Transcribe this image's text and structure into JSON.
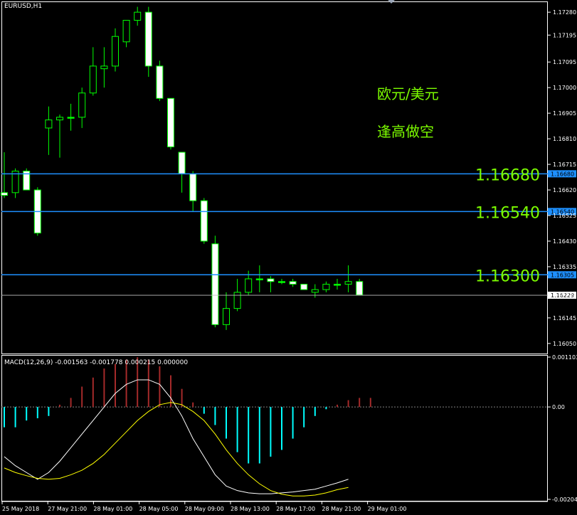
{
  "chart_data": {
    "type": "candlestick",
    "symbol_title": "EURUSD,H1",
    "price_axis": {
      "min": 1.1601,
      "max": 1.1732,
      "ticks": [
        "1.17280",
        "1.17195",
        "1.17095",
        "1.17000",
        "1.16905",
        "1.16810",
        "1.16715",
        "1.16620",
        "1.16525",
        "1.16430",
        "1.16335",
        "1.16235",
        "1.16145",
        "1.16050"
      ]
    },
    "candles": [
      {
        "o": 1.166,
        "h": 1.1676,
        "l": 1.1659,
        "c": 1.1661,
        "dir": "down"
      },
      {
        "o": 1.1661,
        "h": 1.167,
        "l": 1.1659,
        "c": 1.1669,
        "dir": "up"
      },
      {
        "o": 1.1669,
        "h": 1.167,
        "l": 1.1662,
        "c": 1.1662,
        "dir": "down"
      },
      {
        "o": 1.1662,
        "h": 1.1663,
        "l": 1.1645,
        "c": 1.1646,
        "dir": "down"
      },
      {
        "o": 1.1685,
        "h": 1.1693,
        "l": 1.1675,
        "c": 1.1688,
        "dir": "up"
      },
      {
        "o": 1.1688,
        "h": 1.169,
        "l": 1.1674,
        "c": 1.1689,
        "dir": "up"
      },
      {
        "o": 1.1689,
        "h": 1.1694,
        "l": 1.1684,
        "c": 1.1689,
        "dir": "flat"
      },
      {
        "o": 1.1689,
        "h": 1.17,
        "l": 1.1685,
        "c": 1.1698,
        "dir": "up"
      },
      {
        "o": 1.1698,
        "h": 1.1715,
        "l": 1.1697,
        "c": 1.1708,
        "dir": "up"
      },
      {
        "o": 1.1707,
        "h": 1.1715,
        "l": 1.17,
        "c": 1.1708,
        "dir": "up"
      },
      {
        "o": 1.1708,
        "h": 1.1722,
        "l": 1.1706,
        "c": 1.1719,
        "dir": "up"
      },
      {
        "o": 1.1717,
        "h": 1.1725,
        "l": 1.1715,
        "c": 1.1725,
        "dir": "up"
      },
      {
        "o": 1.1725,
        "h": 1.173,
        "l": 1.1723,
        "c": 1.1728,
        "dir": "up"
      },
      {
        "o": 1.1728,
        "h": 1.173,
        "l": 1.1704,
        "c": 1.1708,
        "dir": "down"
      },
      {
        "o": 1.1708,
        "h": 1.171,
        "l": 1.1695,
        "c": 1.1696,
        "dir": "down"
      },
      {
        "o": 1.1696,
        "h": 1.1696,
        "l": 1.1677,
        "c": 1.1678,
        "dir": "down"
      },
      {
        "o": 1.1676,
        "h": 1.1676,
        "l": 1.1661,
        "c": 1.1668,
        "dir": "down"
      },
      {
        "o": 1.1668,
        "h": 1.1669,
        "l": 1.1654,
        "c": 1.1658,
        "dir": "down"
      },
      {
        "o": 1.1658,
        "h": 1.1659,
        "l": 1.1642,
        "c": 1.1643,
        "dir": "down"
      },
      {
        "o": 1.1642,
        "h": 1.1645,
        "l": 1.1611,
        "c": 1.1612,
        "dir": "down"
      },
      {
        "o": 1.1612,
        "h": 1.1624,
        "l": 1.161,
        "c": 1.1618,
        "dir": "up"
      },
      {
        "o": 1.1618,
        "h": 1.1629,
        "l": 1.1617,
        "c": 1.1624,
        "dir": "up"
      },
      {
        "o": 1.1624,
        "h": 1.1632,
        "l": 1.1623,
        "c": 1.1629,
        "dir": "up"
      },
      {
        "o": 1.1629,
        "h": 1.1634,
        "l": 1.1624,
        "c": 1.1629,
        "dir": "flat"
      },
      {
        "o": 1.1629,
        "h": 1.163,
        "l": 1.1624,
        "c": 1.1628,
        "dir": "down"
      },
      {
        "o": 1.1628,
        "h": 1.1629,
        "l": 1.1627,
        "c": 1.1628,
        "dir": "flat"
      },
      {
        "o": 1.1628,
        "h": 1.1629,
        "l": 1.1626,
        "c": 1.1627,
        "dir": "down"
      },
      {
        "o": 1.1627,
        "h": 1.1627,
        "l": 1.1625,
        "c": 1.1625,
        "dir": "down"
      },
      {
        "o": 1.1625,
        "h": 1.1627,
        "l": 1.1622,
        "c": 1.1624,
        "dir": "up"
      },
      {
        "o": 1.1625,
        "h": 1.1628,
        "l": 1.1624,
        "c": 1.1627,
        "dir": "up"
      },
      {
        "o": 1.1627,
        "h": 1.1629,
        "l": 1.1625,
        "c": 1.1627,
        "dir": "flat"
      },
      {
        "o": 1.1627,
        "h": 1.1634,
        "l": 1.1624,
        "c": 1.1628,
        "dir": "up"
      },
      {
        "o": 1.1628,
        "h": 1.1629,
        "l": 1.1623,
        "c": 1.1623,
        "dir": "down"
      }
    ],
    "levels": [
      {
        "price": 1.1668,
        "label": "1.16680",
        "tag": "1.16680"
      },
      {
        "price": 1.1654,
        "label": "1.16540",
        "tag": "1.16540"
      },
      {
        "price": 1.16305,
        "label": "1.16300",
        "tag": "1.16305"
      }
    ],
    "current_price": {
      "price": 1.16229,
      "tag": "1.16229"
    },
    "annotations": [
      "欧元/美元",
      "逢高做空"
    ],
    "macd": {
      "title": "MACD(12,26,9) -0.001563 -0.001778 0.000215 0.000000",
      "axis": {
        "max": 0.001103,
        "min": -0.002044,
        "ticks": [
          "0.001103",
          "0.00",
          "-0.002044"
        ]
      },
      "histogram": [
        -0.00045,
        -0.00045,
        -0.0003,
        -0.00025,
        -0.0002,
        5e-05,
        0.0002,
        0.00045,
        0.00065,
        0.00085,
        0.00095,
        0.00105,
        0.0011,
        0.00105,
        0.0009,
        0.0007,
        0.0004,
        0.0001,
        -0.00015,
        -0.0004,
        -0.0007,
        -0.001,
        -0.00125,
        -0.00125,
        -0.0011,
        -0.00095,
        -0.0007,
        -0.00045,
        -0.0002,
        -5e-05,
        5e-05,
        0.00015,
        0.0002,
        0.0002
      ],
      "hist_color_pos": "#a52a2a",
      "hist_color_neg": "#00ffff",
      "main_line": [
        -0.0011,
        -0.0013,
        -0.00145,
        -0.0016,
        -0.00145,
        -0.0012,
        -0.0009,
        -0.0006,
        -0.0003,
        0.0,
        0.0003,
        0.0005,
        0.0006,
        0.0006,
        0.0005,
        0.0002,
        -0.0002,
        -0.0007,
        -0.0011,
        -0.0015,
        -0.00175,
        -0.00185,
        -0.0019,
        -0.00192,
        -0.00192,
        -0.0019,
        -0.00188,
        -0.00185,
        -0.00182,
        -0.00175,
        -0.00168,
        -0.0016
      ],
      "signal_line": [
        -0.00135,
        -0.00145,
        -0.00152,
        -0.00158,
        -0.0016,
        -0.00158,
        -0.0015,
        -0.0014,
        -0.00125,
        -0.00105,
        -0.0008,
        -0.00055,
        -0.0003,
        -0.0001,
        5e-05,
        0.0001,
        5e-05,
        -0.0001,
        -0.0003,
        -0.0006,
        -0.00095,
        -0.00125,
        -0.0015,
        -0.0017,
        -0.00185,
        -0.00193,
        -0.00197,
        -0.00197,
        -0.00195,
        -0.0019,
        -0.00183,
        -0.00178
      ]
    },
    "time_labels": [
      "25 May 2018",
      "27 May 21:00",
      "28 May 01:00",
      "28 May 05:00",
      "28 May 09:00",
      "28 May 13:00",
      "28 May 17:00",
      "28 May 21:00",
      "29 May 01:00"
    ],
    "colors": {
      "background": "#000000",
      "bull_fill": "#000000",
      "bear_fill": "#ffffff",
      "wick": "#00ff00",
      "level_line": "#1e90ff",
      "level_tag_bg": "#1e90ff",
      "current_line": "#c0c0c0",
      "annotation": "#7CFC00",
      "macd_main": "#ffffff",
      "macd_signal": "#ffff00",
      "grid_zero": "#808080"
    }
  }
}
